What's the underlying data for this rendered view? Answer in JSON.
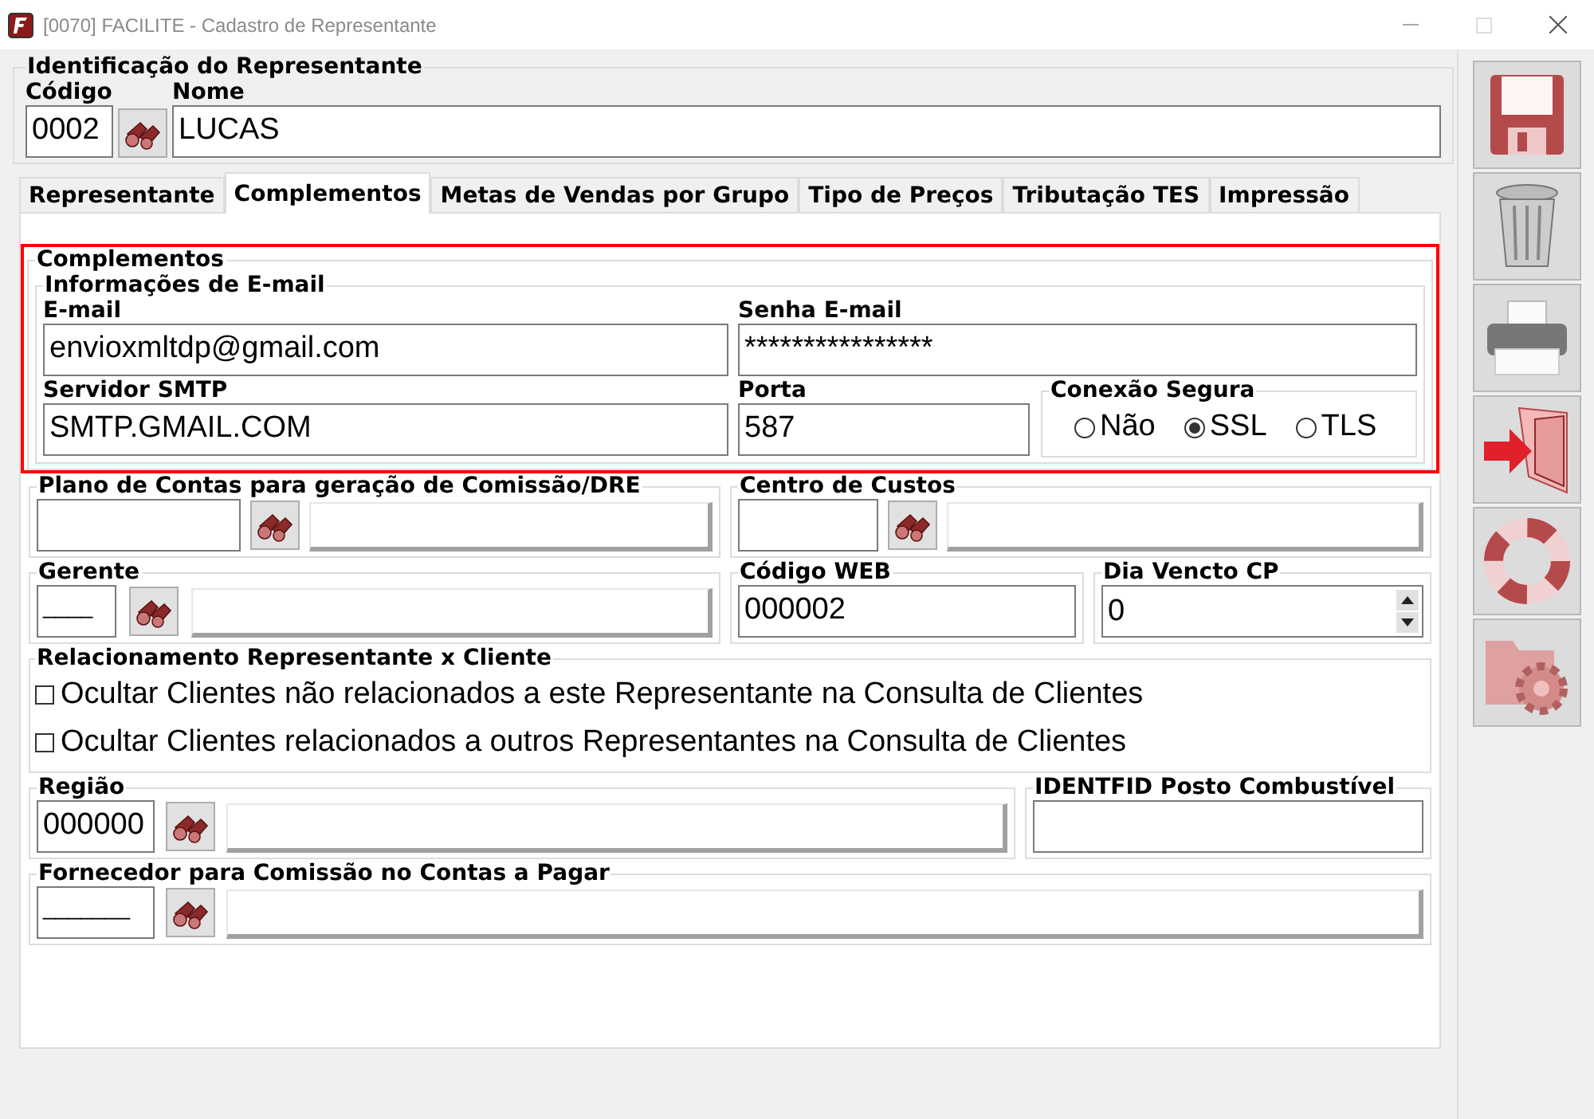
{
  "window": {
    "title": "[0070] FACILITE - Cadastro de Representante"
  },
  "identification": {
    "title": "Identificação do Representante",
    "code": {
      "label": "Código",
      "value": "0002"
    },
    "name": {
      "label": "Nome",
      "value": "LUCAS"
    }
  },
  "tabs": [
    {
      "label": "Representante",
      "selected": false
    },
    {
      "label": "Complementos",
      "selected": true
    },
    {
      "label": "Metas de Vendas por Grupo",
      "selected": false
    },
    {
      "label": "Tipo de Preços",
      "selected": false
    },
    {
      "label": "Tributação TES",
      "selected": false
    },
    {
      "label": "Impressão",
      "selected": false
    }
  ],
  "complementos": {
    "title": "Complementos",
    "highlighted": true,
    "email_info": {
      "title": "Informações de E-mail",
      "email": {
        "label": "E-mail",
        "value": "envioxmltdp@gmail.com"
      },
      "password": {
        "label": "Senha E-mail",
        "value": "****************"
      },
      "smtp": {
        "label": "Servidor SMTP",
        "value": "SMTP.GMAIL.COM"
      },
      "port": {
        "label": "Porta",
        "value": "587"
      },
      "secure_connection": {
        "title": "Conexão Segura",
        "options": [
          {
            "label": "Não",
            "selected": false
          },
          {
            "label": "SSL",
            "selected": true
          },
          {
            "label": "TLS",
            "selected": false
          }
        ]
      }
    }
  },
  "plano_contas": {
    "title": "Plano de Contas para geração de Comissão/DRE"
  },
  "centro_custos": {
    "title": "Centro de Custos"
  },
  "gerente": {
    "title": "Gerente",
    "value": "____"
  },
  "codigo_web": {
    "title": "Código WEB",
    "value": "000002"
  },
  "dia_vencto": {
    "title": "Dia Vencto CP",
    "value": "0"
  },
  "relacionamento": {
    "title": "Relacionamento Representante x Cliente",
    "options": [
      {
        "label": "Ocultar Clientes não relacionados a este Representante na Consulta de Clientes",
        "checked": false
      },
      {
        "label": "Ocultar Clientes relacionados a outros Representantes na Consulta de Clientes",
        "checked": false
      }
    ]
  },
  "regiao": {
    "title": "Região",
    "value": "000000"
  },
  "identfid": {
    "title": "IDENTFID Posto Combustível"
  },
  "fornecedor": {
    "title": "Fornecedor para Comissão no Contas a Pagar",
    "value": "_______"
  },
  "toolbar": [
    {
      "kind": "save"
    },
    {
      "kind": "delete"
    },
    {
      "kind": "print"
    },
    {
      "kind": "exit"
    },
    {
      "kind": "help"
    },
    {
      "kind": "settings"
    }
  ]
}
